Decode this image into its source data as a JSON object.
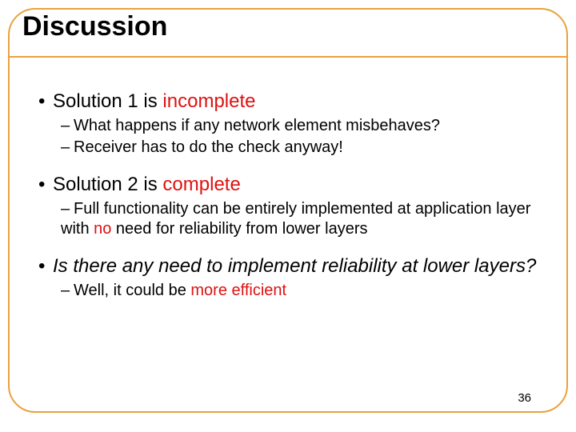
{
  "title": "Discussion",
  "page_number": "36",
  "b1": {
    "prefix": "Solution 1 is ",
    "em": "incomplete"
  },
  "b1s1": "What happens if any network element misbehaves?",
  "b1s2": "Receiver has to do the check anyway!",
  "b2": {
    "prefix": "Solution 2 is ",
    "em": "complete"
  },
  "b2s1": {
    "a": "Full functionality can be entirely implemented at application layer with ",
    "em": "no",
    "b": " need for reliability from lower layers"
  },
  "b3": "Is there any need to implement reliability at lower layers?",
  "b3s1": {
    "a": "Well, it could be ",
    "em": "more efficient"
  }
}
